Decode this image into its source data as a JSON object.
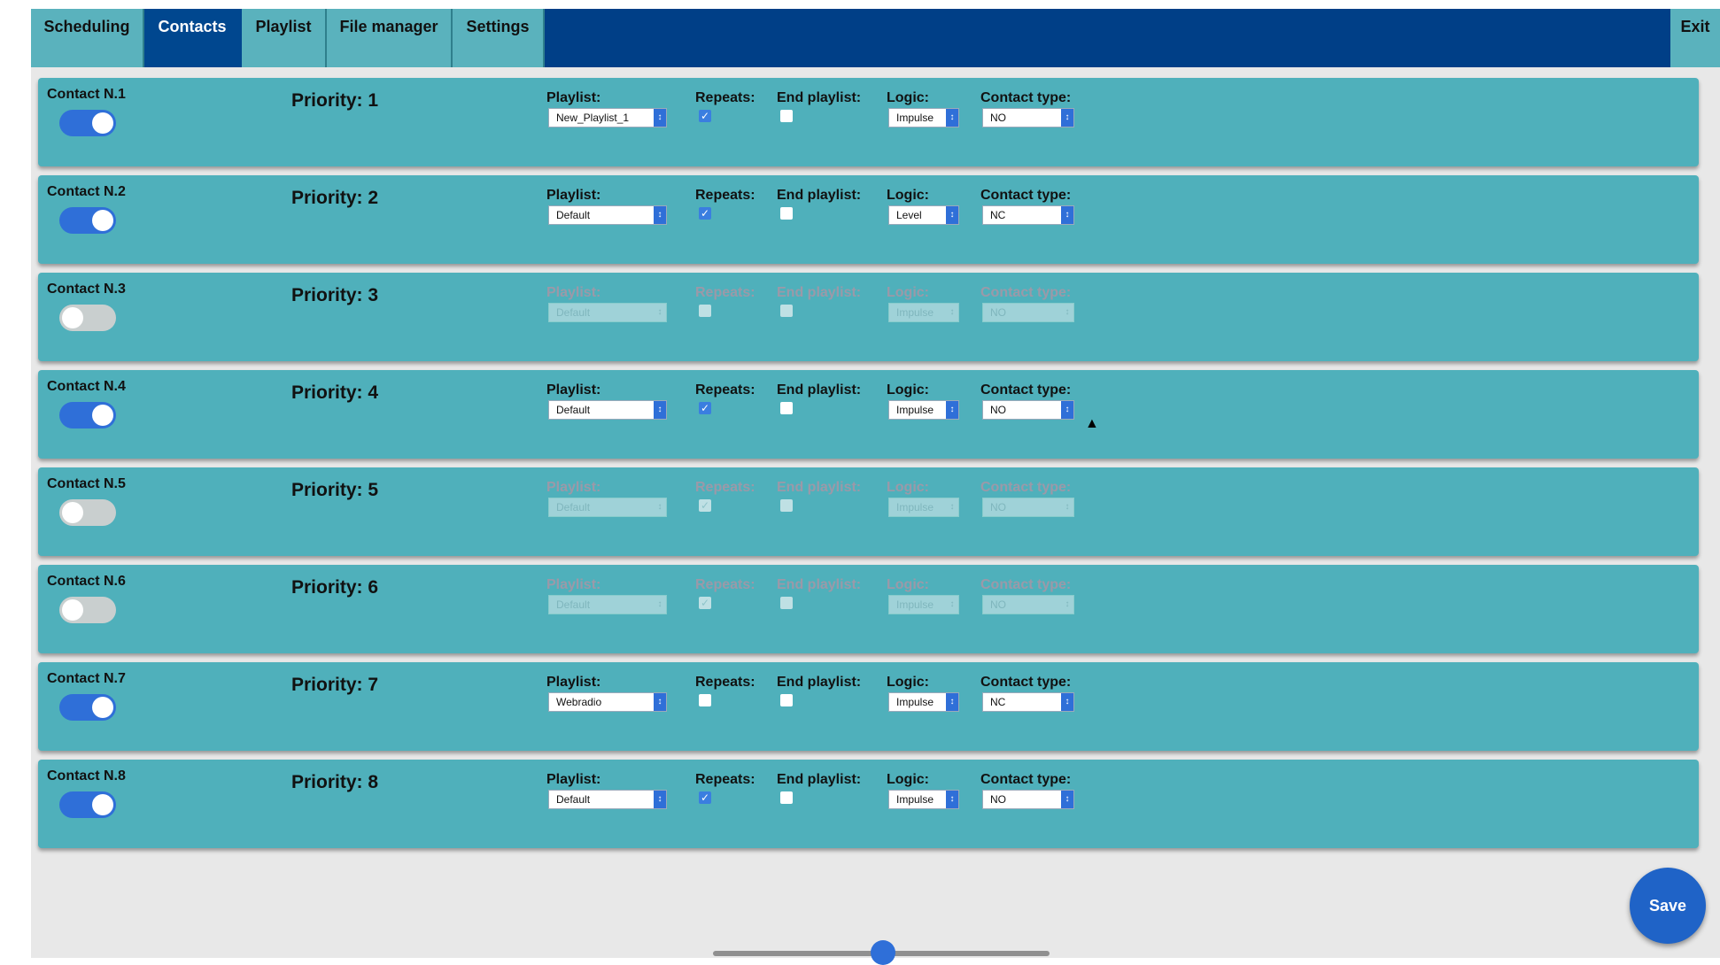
{
  "nav": {
    "tabs": [
      {
        "label": "Scheduling",
        "active": false
      },
      {
        "label": "Contacts",
        "active": true
      },
      {
        "label": "Playlist",
        "active": false
      },
      {
        "label": "File manager",
        "active": false
      },
      {
        "label": "Settings",
        "active": false
      }
    ],
    "exit_label": "Exit"
  },
  "field_labels": {
    "playlist": "Playlist:",
    "repeats": "Repeats:",
    "end_playlist": "End playlist:",
    "logic": "Logic:",
    "contact_type": "Contact type:"
  },
  "contacts": [
    {
      "name": "Contact N.1",
      "enabled": true,
      "priority": "Priority: 1",
      "playlist": "New_Playlist_1",
      "repeats": true,
      "end_playlist": false,
      "logic": "Impulse",
      "contact_type": "NO"
    },
    {
      "name": "Contact N.2",
      "enabled": true,
      "priority": "Priority: 2",
      "playlist": "Default",
      "repeats": true,
      "end_playlist": false,
      "logic": "Level",
      "contact_type": "NC"
    },
    {
      "name": "Contact N.3",
      "enabled": false,
      "priority": "Priority: 3",
      "playlist": "Default",
      "repeats": false,
      "end_playlist": false,
      "logic": "Impulse",
      "contact_type": "NO"
    },
    {
      "name": "Contact N.4",
      "enabled": true,
      "priority": "Priority: 4",
      "playlist": "Default",
      "repeats": true,
      "end_playlist": false,
      "logic": "Impulse",
      "contact_type": "NO"
    },
    {
      "name": "Contact N.5",
      "enabled": false,
      "priority": "Priority: 5",
      "playlist": "Default",
      "repeats": true,
      "end_playlist": false,
      "logic": "Impulse",
      "contact_type": "NO"
    },
    {
      "name": "Contact N.6",
      "enabled": false,
      "priority": "Priority: 6",
      "playlist": "Default",
      "repeats": true,
      "end_playlist": false,
      "logic": "Impulse",
      "contact_type": "NO"
    },
    {
      "name": "Contact N.7",
      "enabled": true,
      "priority": "Priority: 7",
      "playlist": "Webradio",
      "repeats": false,
      "end_playlist": false,
      "logic": "Impulse",
      "contact_type": "NC"
    },
    {
      "name": "Contact N.8",
      "enabled": true,
      "priority": "Priority: 8",
      "playlist": "Default",
      "repeats": true,
      "end_playlist": false,
      "logic": "Impulse",
      "contact_type": "NO"
    }
  ],
  "save_label": "Save",
  "icons": {
    "dropdown": "updown-arrow-icon",
    "check": "checkmark-icon",
    "cursor": "mouse-pointer-icon"
  }
}
